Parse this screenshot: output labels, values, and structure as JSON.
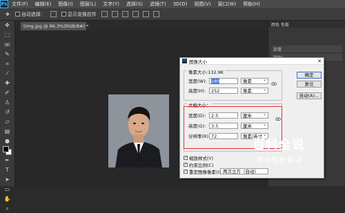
{
  "app": {
    "logo": "Ps"
  },
  "menu": [
    "文件(F)",
    "编辑(E)",
    "图像(I)",
    "图层(L)",
    "文字(Y)",
    "选择(S)",
    "滤镜(T)",
    "3D(D)",
    "视图(V)",
    "窗口(W)",
    "帮助(H)"
  ],
  "options": {
    "auto_select": "自动选择：",
    "show_transform": "显示变换控件"
  },
  "document": {
    "tab_title": "timg.jpg @ 86.3%(RGB/8#) *"
  },
  "right_dock": {
    "panel_tabs": [
      "颜色",
      "色板"
    ],
    "mode": "正常",
    "lock": "锁定："
  },
  "dialog": {
    "title": "图像大小",
    "pixel_group": "像素大小:132.9K",
    "pixel_width_label": "宽度(W):",
    "pixel_width_value": "180",
    "pixel_height_label": "高度(H):",
    "pixel_height_value": "252",
    "pixel_unit": "像素",
    "doc_group": "文档大小：",
    "doc_width_label": "宽度(D):",
    "doc_width_value": "2.5",
    "doc_height_label": "高度(G):",
    "doc_height_value": "3.5",
    "resolution_label": "分辨率(R):",
    "resolution_value": "72",
    "doc_unit": "厘米",
    "resolution_unit": "像素/英寸",
    "ok": "确定",
    "reset": "复位",
    "auto": "自动(A)...",
    "scale_styles": "缩放样式(Y)",
    "constrain": "约束比例(C)",
    "resample": "重定图像像素(I):",
    "resample_method": "两次立方（自动）"
  },
  "watermark": {
    "title": "百科全说",
    "subtitle": "助你轻松解决"
  },
  "colors": {
    "highlight_red": "#e0303a",
    "selection_blue": "#3c78d8"
  }
}
